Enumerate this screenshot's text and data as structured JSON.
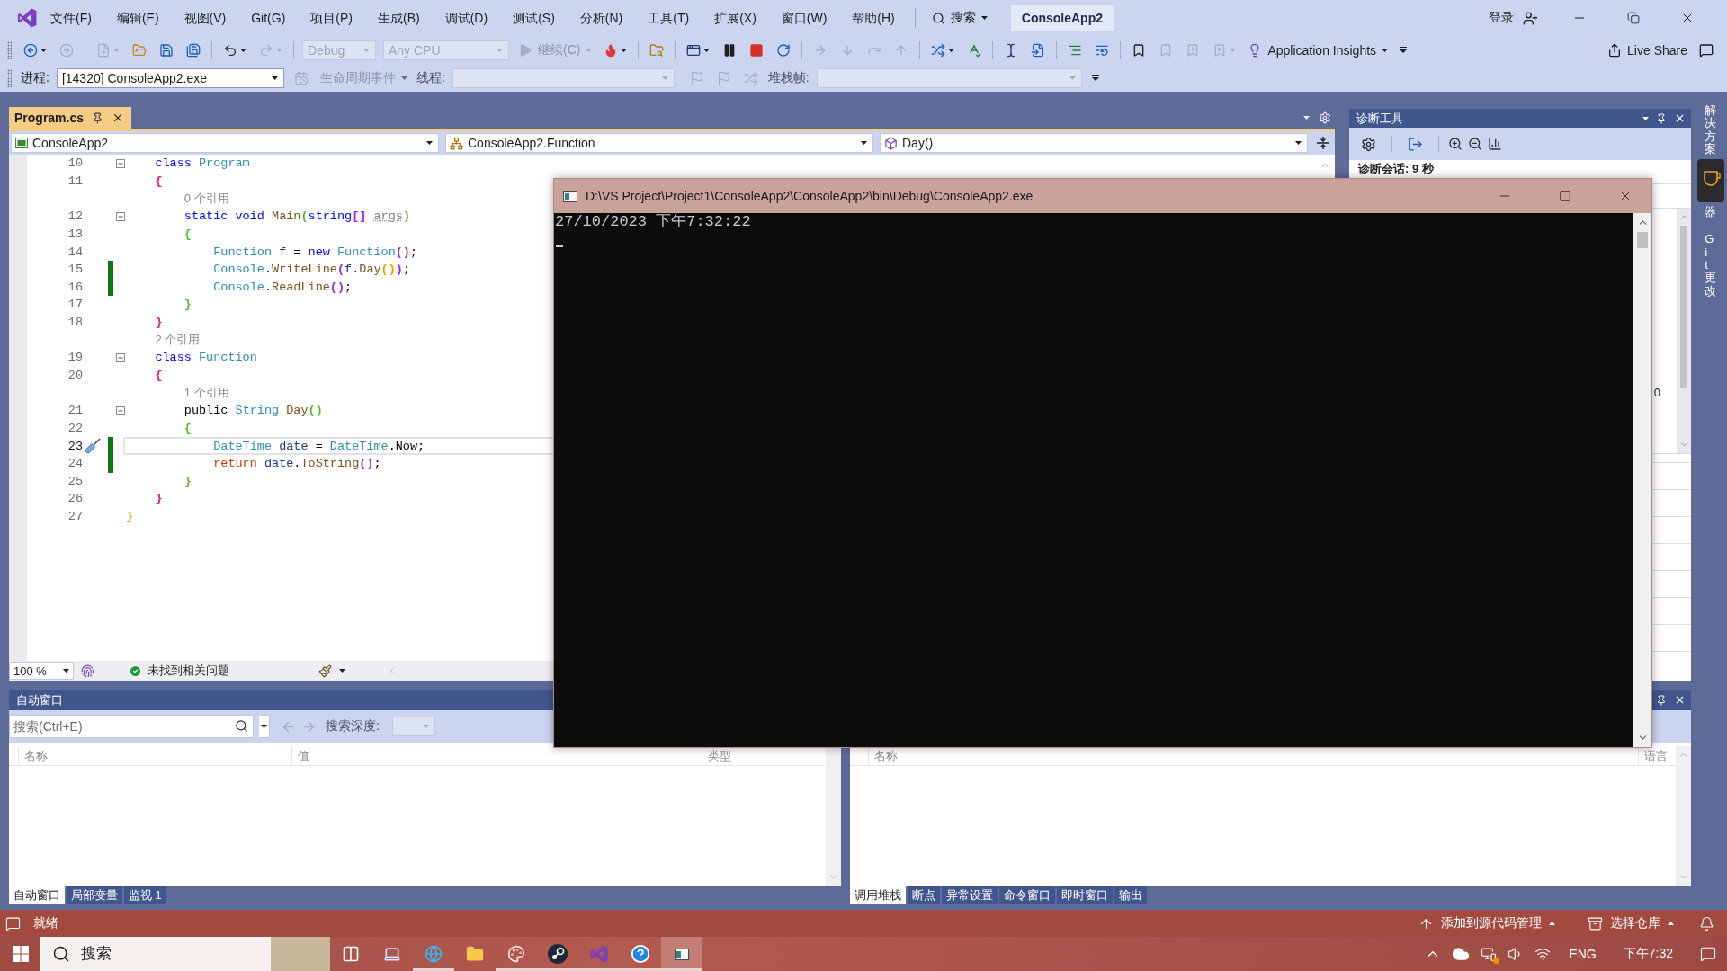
{
  "menu_bar": {
    "items": [
      "文件(F)",
      "编辑(E)",
      "视图(V)",
      "Git(G)",
      "项目(P)",
      "生成(B)",
      "调试(D)",
      "测试(S)",
      "分析(N)",
      "工具(T)",
      "扩展(X)",
      "窗口(W)",
      "帮助(H)"
    ],
    "search": "搜索",
    "solution": "ConsoleApp2",
    "sign_in": "登录"
  },
  "toolbar": {
    "items": [
      {
        "kind": "icon",
        "dropdown": true,
        "disabled": false
      },
      {
        "kind": "icon",
        "dropdown": false,
        "disabled": true
      },
      {
        "kind": "separator"
      },
      {
        "kind": "icon",
        "dropdown": true,
        "disabled": true
      },
      {
        "kind": "icon",
        "dropdown": false,
        "disabled": false
      },
      {
        "kind": "icon",
        "dropdown": false,
        "disabled": false
      },
      {
        "kind": "icon",
        "dropdown": false,
        "disabled": false
      },
      {
        "kind": "separator"
      },
      {
        "kind": "icon",
        "dropdown": true,
        "disabled": false
      },
      {
        "kind": "icon",
        "dropdown": true,
        "disabled": true
      },
      {
        "kind": "separator"
      },
      {
        "kind": "dropdown",
        "value": "Debug",
        "disabled": true
      },
      {
        "kind": "dropdown",
        "value": "Any CPU",
        "disabled": true
      },
      {
        "kind": "button",
        "label": "继续(C)",
        "dropdown": true,
        "disabled": true
      },
      {
        "kind": "icon",
        "dropdown": true,
        "disabled": false
      },
      {
        "kind": "separator"
      },
      {
        "kind": "icon",
        "dropdown": false,
        "disabled": false
      },
      {
        "kind": "separator"
      },
      {
        "kind": "icon",
        "dropdown": true,
        "disabled": false
      },
      {
        "kind": "icon",
        "dropdown": false,
        "disabled": false
      },
      {
        "kind": "icon",
        "dropdown": false,
        "disabled": false
      },
      {
        "kind": "icon",
        "dropdown": false,
        "disabled": false
      },
      {
        "kind": "separator"
      },
      {
        "kind": "icon",
        "dropdown": false,
        "disabled": true
      },
      {
        "kind": "icon",
        "dropdown": false,
        "disabled": true
      },
      {
        "kind": "icon",
        "dropdown": false,
        "disabled": true
      },
      {
        "kind": "icon",
        "dropdown": false,
        "disabled": true
      },
      {
        "kind": "separator"
      },
      {
        "kind": "icon",
        "dropdown": true,
        "disabled": false
      },
      {
        "kind": "icon",
        "dropdown": false,
        "disabled": false
      },
      {
        "kind": "separator"
      },
      {
        "kind": "icon",
        "dropdown": false,
        "disabled": false
      },
      {
        "kind": "icon",
        "dropdown": false,
        "disabled": false
      },
      {
        "kind": "separator"
      },
      {
        "kind": "icon",
        "dropdown": false,
        "disabled": false
      },
      {
        "kind": "icon",
        "dropdown": false,
        "disabled": false
      },
      {
        "kind": "separator"
      },
      {
        "kind": "icon",
        "dropdown": false,
        "disabled": false
      },
      {
        "kind": "icon",
        "dropdown": false,
        "disabled": true
      },
      {
        "kind": "icon",
        "dropdown": false,
        "disabled": true
      },
      {
        "kind": "icon",
        "dropdown": true,
        "disabled": true
      },
      {
        "kind": "button",
        "label": "Application Insights",
        "dropdown": true,
        "disabled": false
      },
      {
        "kind": "overflow"
      }
    ],
    "right_items": [
      {
        "kind": "button",
        "label": "Live Share",
        "dropdown": false,
        "disabled": false
      },
      {
        "kind": "icon",
        "dropdown": false,
        "disabled": false
      }
    ]
  },
  "debug_toolbar": {
    "process_label": "进程:",
    "process": "[14320] ConsoleApp2.exe",
    "lifecycle": {
      "label": "生命周期事件",
      "disabled": true
    },
    "thread_label": "线程:",
    "thread_disabled": true,
    "flags_disabled": true,
    "stack_frame_label": "堆栈帧:",
    "stack_frame_disabled": true
  },
  "editor": {
    "tab": {
      "title": "Program.cs",
      "selected": true
    },
    "nav": [
      "ConsoleApp2",
      "ConsoleApp2.Function",
      "Day()"
    ],
    "lines": [
      {
        "kind": "code",
        "number": "10",
        "fold": true,
        "changed": false,
        "current": false,
        "quick_action": false,
        "tokens": [
          {
            "text": "    class ",
            "kind": "keyword"
          },
          {
            "text": "Program",
            "kind": "type"
          }
        ]
      },
      {
        "kind": "code",
        "number": "11",
        "fold": false,
        "changed": false,
        "current": false,
        "quick_action": false,
        "tokens": [
          {
            "text": "    {",
            "kind": "brace",
            "color": "#e3178c"
          }
        ]
      },
      {
        "kind": "codelens",
        "text": "        0 个引用"
      },
      {
        "kind": "code",
        "number": "12",
        "fold": true,
        "changed": false,
        "current": false,
        "quick_action": false,
        "tokens": [
          {
            "text": "        static void ",
            "kind": "keyword"
          },
          {
            "text": "Main",
            "kind": "method"
          },
          {
            "text": "(",
            "kind": "brace",
            "color": "#5cb82e"
          },
          {
            "text": "string",
            "kind": "keyword"
          },
          {
            "text": "[] ",
            "kind": "brace",
            "color": "#a020f0"
          },
          {
            "text": "args",
            "kind": "param"
          },
          {
            "text": ")",
            "kind": "brace",
            "color": "#5cb82e"
          }
        ]
      },
      {
        "kind": "code",
        "number": "13",
        "fold": false,
        "changed": false,
        "current": false,
        "quick_action": false,
        "tokens": [
          {
            "text": "        {",
            "kind": "brace",
            "color": "#5cb82e"
          }
        ]
      },
      {
        "kind": "code",
        "number": "14",
        "fold": false,
        "changed": false,
        "current": false,
        "quick_action": false,
        "tokens": [
          {
            "text": "            Function",
            "kind": "type"
          },
          {
            "text": " f",
            "kind": "local"
          },
          {
            "text": " = ",
            "kind": "plain"
          },
          {
            "text": "new ",
            "kind": "keyword"
          },
          {
            "text": "Function",
            "kind": "type"
          },
          {
            "text": "()",
            "kind": "brace",
            "color": "#a020f0"
          },
          {
            "text": ";",
            "kind": "plain"
          }
        ]
      },
      {
        "kind": "code",
        "number": "15",
        "fold": false,
        "changed": true,
        "current": false,
        "quick_action": false,
        "tokens": [
          {
            "text": "            Console",
            "kind": "type"
          },
          {
            "text": ".",
            "kind": "plain"
          },
          {
            "text": "WriteLine",
            "kind": "method"
          },
          {
            "text": "(",
            "kind": "brace",
            "color": "#a020f0"
          },
          {
            "text": "f",
            "kind": "local"
          },
          {
            "text": ".",
            "kind": "plain"
          },
          {
            "text": "Day",
            "kind": "method"
          },
          {
            "text": "()",
            "kind": "brace",
            "color": "#f0a000"
          },
          {
            "text": ")",
            "kind": "brace",
            "color": "#a020f0"
          },
          {
            "text": ";",
            "kind": "plain"
          }
        ]
      },
      {
        "kind": "code",
        "number": "16",
        "fold": false,
        "changed": true,
        "current": false,
        "quick_action": false,
        "tokens": [
          {
            "text": "            Console",
            "kind": "type"
          },
          {
            "text": ".",
            "kind": "plain"
          },
          {
            "text": "ReadLine",
            "kind": "method"
          },
          {
            "text": "()",
            "kind": "brace",
            "color": "#a020f0"
          },
          {
            "text": ";",
            "kind": "plain"
          }
        ]
      },
      {
        "kind": "code",
        "number": "17",
        "fold": false,
        "changed": false,
        "current": false,
        "quick_action": false,
        "tokens": [
          {
            "text": "        }",
            "kind": "brace",
            "color": "#5cb82e"
          }
        ]
      },
      {
        "kind": "code",
        "number": "18",
        "fold": false,
        "changed": false,
        "current": false,
        "quick_action": false,
        "tokens": [
          {
            "text": "    }",
            "kind": "brace",
            "color": "#e3178c"
          }
        ]
      },
      {
        "kind": "codelens",
        "text": "    2 个引用"
      },
      {
        "kind": "code",
        "number": "19",
        "fold": true,
        "changed": false,
        "current": false,
        "quick_action": false,
        "tokens": [
          {
            "text": "    class ",
            "kind": "keyword"
          },
          {
            "text": "Function",
            "kind": "type"
          }
        ]
      },
      {
        "kind": "code",
        "number": "20",
        "fold": false,
        "changed": false,
        "current": false,
        "quick_action": false,
        "tokens": [
          {
            "text": "    {",
            "kind": "brace",
            "color": "#e3178c"
          }
        ]
      },
      {
        "kind": "codelens",
        "text": "        1 个引用"
      },
      {
        "kind": "code",
        "number": "21",
        "fold": true,
        "changed": false,
        "current": false,
        "quick_action": false,
        "tokens": [
          {
            "text": "        public ",
            "kind": "plain"
          },
          {
            "text": "String ",
            "kind": "type"
          },
          {
            "text": "Day",
            "kind": "method"
          },
          {
            "text": "()",
            "kind": "brace",
            "color": "#5cb82e"
          }
        ]
      },
      {
        "kind": "code",
        "number": "22",
        "fold": false,
        "changed": false,
        "current": false,
        "quick_action": false,
        "tokens": [
          {
            "text": "        {",
            "kind": "brace",
            "color": "#5cb82e"
          }
        ]
      },
      {
        "kind": "code",
        "number": "23",
        "fold": false,
        "changed": true,
        "current": true,
        "quick_action": true,
        "tokens": [
          {
            "text": "            DateTime",
            "kind": "type"
          },
          {
            "text": " date",
            "kind": "local"
          },
          {
            "text": " = ",
            "kind": "plain"
          },
          {
            "text": "DateTime",
            "kind": "type"
          },
          {
            "text": ".Now;",
            "kind": "plain"
          }
        ]
      },
      {
        "kind": "code",
        "number": "24",
        "fold": false,
        "changed": true,
        "current": false,
        "quick_action": false,
        "tokens": [
          {
            "text": "            return ",
            "kind": "control"
          },
          {
            "text": "date",
            "kind": "local"
          },
          {
            "text": ".",
            "kind": "plain"
          },
          {
            "text": "ToString",
            "kind": "method"
          },
          {
            "text": "()",
            "kind": "brace",
            "color": "#a020f0"
          },
          {
            "text": ";",
            "kind": "plain"
          }
        ]
      },
      {
        "kind": "code",
        "number": "25",
        "fold": false,
        "changed": false,
        "current": false,
        "quick_action": false,
        "tokens": [
          {
            "text": "        }",
            "kind": "brace",
            "color": "#5cb82e"
          }
        ]
      },
      {
        "kind": "code",
        "number": "26",
        "fold": false,
        "changed": false,
        "current": false,
        "quick_action": false,
        "tokens": [
          {
            "text": "    }",
            "kind": "brace",
            "color": "#e3178c"
          }
        ]
      },
      {
        "kind": "code",
        "number": "27",
        "fold": false,
        "changed": false,
        "current": false,
        "quick_action": false,
        "tokens": [
          {
            "text": "}",
            "kind": "brace",
            "color": "#f0a000"
          }
        ]
      }
    ],
    "zoom": "100 %",
    "issues": "未找到相关问题"
  },
  "diagnostics": {
    "title": "诊断工具",
    "session": "诊断会话: 9 秒",
    "value": "0"
  },
  "side_tabs": [
    {
      "label_parts": [
        "解决方案",
        "器"
      ]
    },
    {
      "label_parts": [
        "Git 更改"
      ]
    }
  ],
  "console": {
    "title": "D:\\VS Project\\Project1\\ConsoleApp2\\ConsoleApp2\\bin\\Debug\\ConsoleApp2.exe",
    "output": [
      "27/10/2023 下午7:32:22"
    ]
  },
  "autos": {
    "title": "自动窗口",
    "search": {
      "placeholder": "搜索(Ctrl+E)"
    },
    "depth_label": "搜索深度:",
    "columns": [
      "名称",
      "值",
      "类型"
    ],
    "tabs": [
      {
        "label": "自动窗口",
        "selected": true
      },
      {
        "label": "局部变量",
        "selected": false
      },
      {
        "label": "监视 1",
        "selected": false
      }
    ]
  },
  "call_stack": {
    "columns": [
      "名称",
      "语言"
    ],
    "tabs": [
      {
        "label": "调用堆栈",
        "selected": true
      },
      {
        "label": "断点",
        "selected": false
      },
      {
        "label": "异常设置",
        "selected": false
      },
      {
        "label": "命令窗口",
        "selected": false
      },
      {
        "label": "即时窗口",
        "selected": false
      },
      {
        "label": "输出",
        "selected": false
      }
    ]
  },
  "status_bar": {
    "text": "就绪",
    "source_control": "添加到源代码管理",
    "repository": "选择仓库"
  },
  "taskbar": {
    "search": {
      "placeholder": "搜索"
    },
    "apps": [
      {
        "running": false,
        "active": false
      },
      {
        "running": false,
        "active": false
      },
      {
        "running": true,
        "active": false
      },
      {
        "running": false,
        "active": false
      },
      {
        "running": true,
        "active": false
      },
      {
        "running": true,
        "active": false
      },
      {
        "running": true,
        "active": false
      },
      {
        "running": true,
        "active": false
      },
      {
        "running": true,
        "active": true
      }
    ],
    "language": "ENG",
    "clock": "下午7:32"
  }
}
